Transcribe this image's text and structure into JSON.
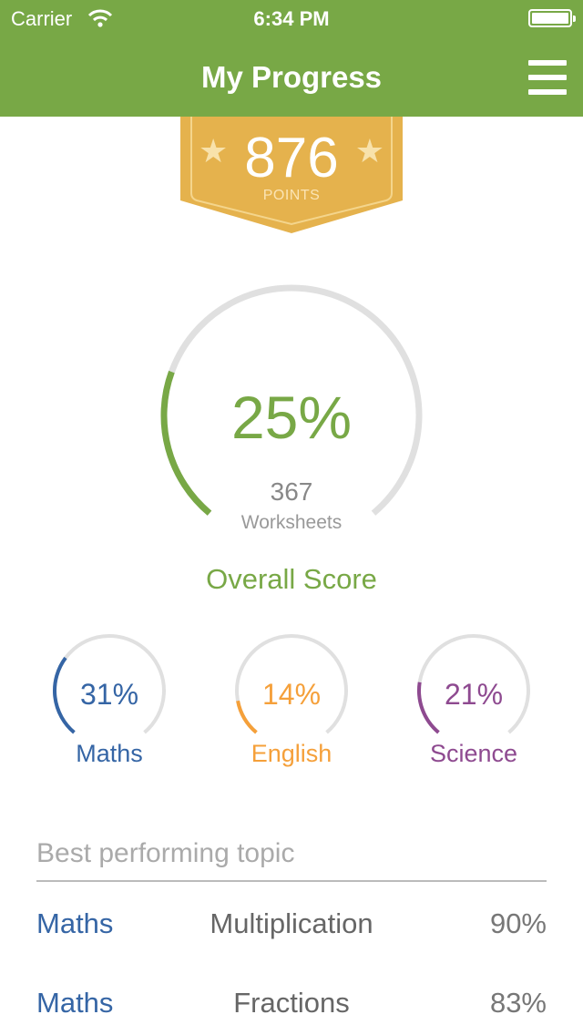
{
  "status_bar": {
    "carrier": "Carrier",
    "time": "6:34 PM",
    "wifi_icon": "wifi-icon",
    "battery_icon": "battery-icon"
  },
  "nav": {
    "title": "My Progress",
    "menu_icon": "hamburger-menu-icon",
    "color": "#78a846"
  },
  "points_badge": {
    "value": "876",
    "label": "POINTS",
    "color": "#e5b24d",
    "star_icon": "star-icon"
  },
  "overall": {
    "percent_label": "25%",
    "percent": 25,
    "count": "367",
    "unit": "Worksheets",
    "label": "Overall Score",
    "color": "#78a846",
    "track_color": "#e0e0e0"
  },
  "subjects": [
    {
      "name": "Maths",
      "percent_label": "31%",
      "percent": 31,
      "color": "#3565a5"
    },
    {
      "name": "English",
      "percent_label": "14%",
      "percent": 14,
      "color": "#f5a03a"
    },
    {
      "name": "Science",
      "percent_label": "21%",
      "percent": 21,
      "color": "#8e4a90"
    }
  ],
  "best_topics": {
    "title": "Best performing topic",
    "rows": [
      {
        "subject": "Maths",
        "topic": "Multiplication",
        "score": "90%"
      },
      {
        "subject": "Maths",
        "topic": "Fractions",
        "score": "83%"
      }
    ]
  }
}
